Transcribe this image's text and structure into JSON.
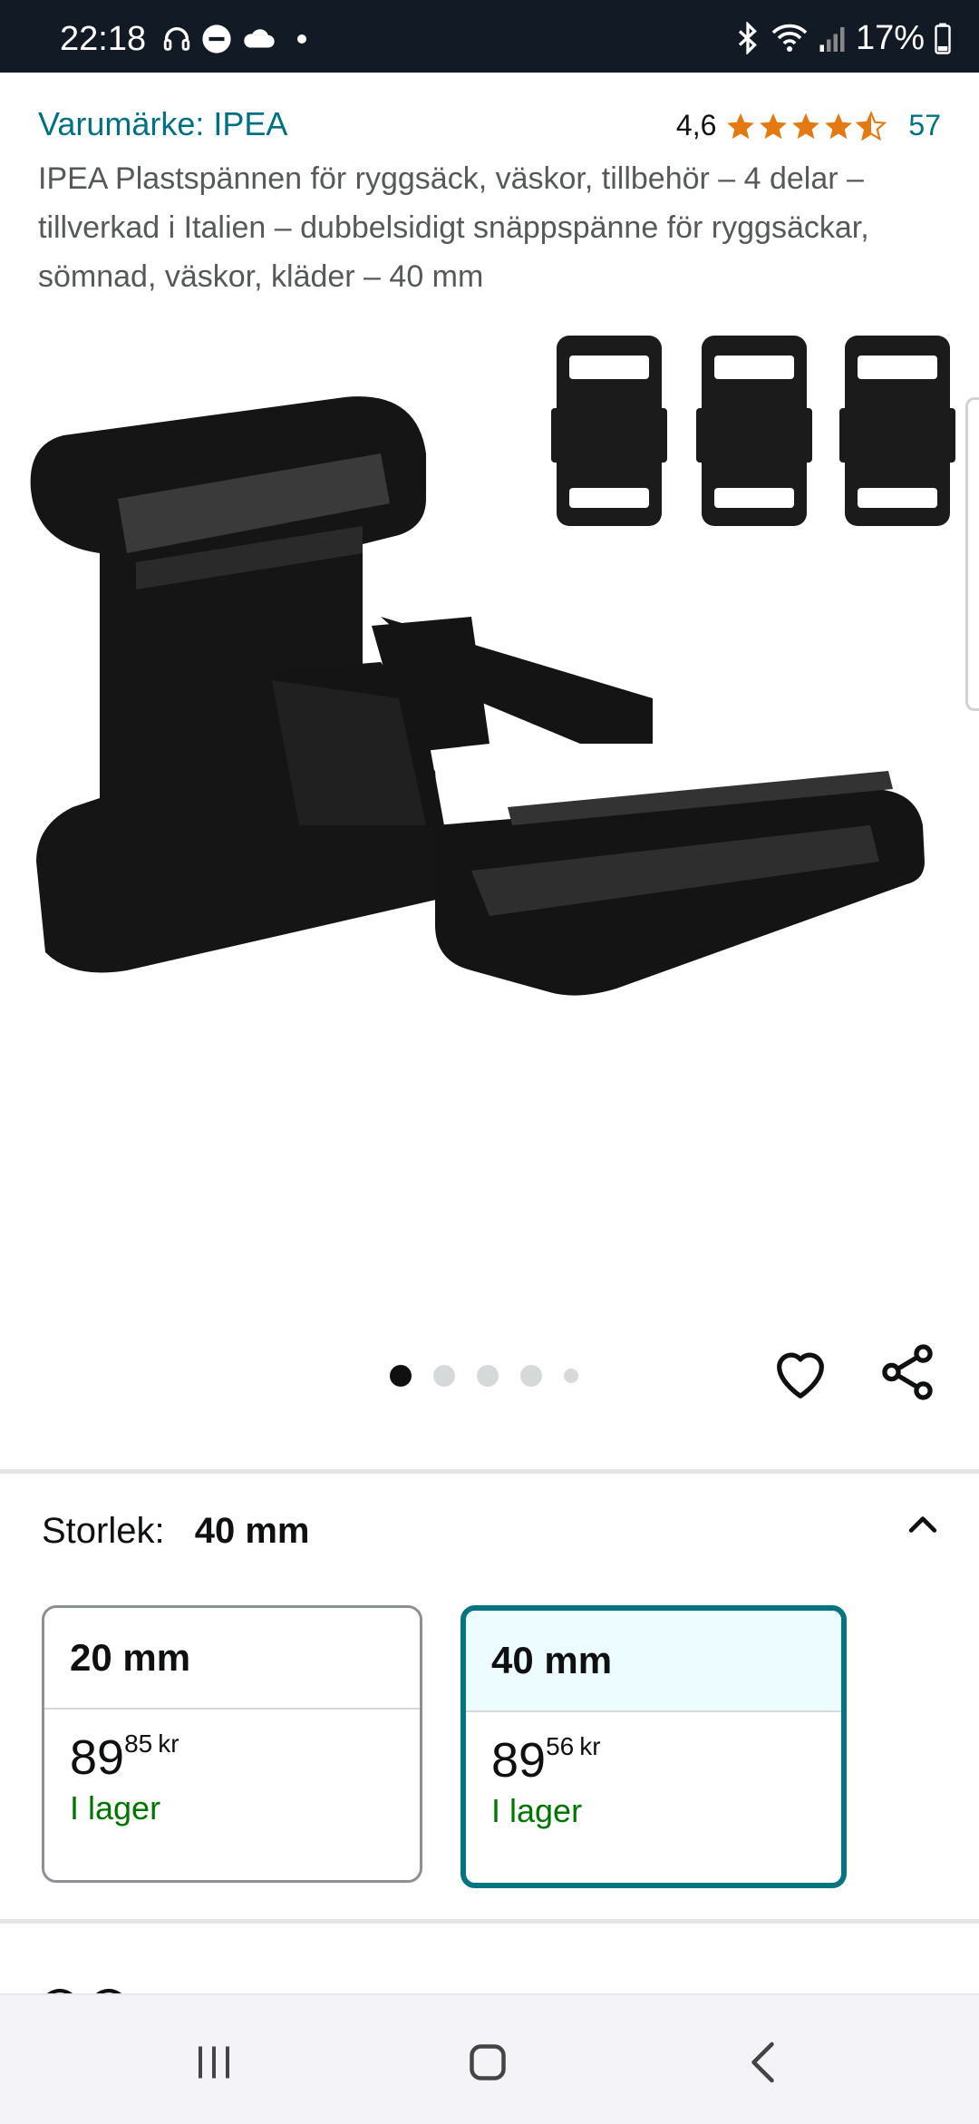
{
  "status_bar": {
    "time": "22:18",
    "battery": "17%",
    "left_icons": [
      "headphones-icon",
      "do-not-disturb-icon",
      "cloud-icon",
      "notification-dot"
    ],
    "right_icons": [
      "bluetooth-icon",
      "wifi-icon",
      "signal-icon",
      "battery-icon"
    ]
  },
  "product": {
    "brand": "Varumärke: IPEA",
    "rating_value": "4,6",
    "stars": 4.5,
    "rating_count": "57",
    "title": "IPEA Plastspännen för ryggsäck, väskor, tillbehör – 4 delar – tillverkad i Italien – dubbelsidigt snäppspänne för ryggsäckar, sömnad, väskor, kläder – 40 mm"
  },
  "gallery": {
    "total_images": 5,
    "active_index": 0
  },
  "size": {
    "label": "Storlek:",
    "selected": "40 mm",
    "options": [
      {
        "label": "20 mm",
        "price_whole": "89",
        "price_fraction": "85",
        "currency": "kr",
        "stock": "I lager",
        "selected": false
      },
      {
        "label": "40 mm",
        "price_whole": "89",
        "price_fraction": "56",
        "currency": "kr",
        "stock": "I lager",
        "selected": true
      }
    ]
  },
  "colors": {
    "link": "#007185",
    "selected_border": "#047481",
    "in_stock": "#007600",
    "star": "#e47911"
  },
  "nav": {
    "buttons": [
      "recent-apps",
      "home",
      "back"
    ]
  }
}
